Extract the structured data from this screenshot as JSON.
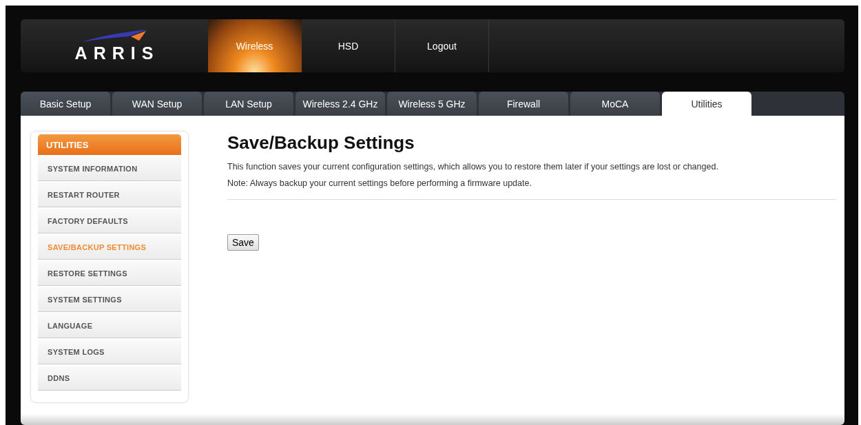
{
  "header": {
    "logo": "ARRIS",
    "nav": [
      {
        "label": "Wireless",
        "selected": true
      },
      {
        "label": "HSD",
        "selected": false
      },
      {
        "label": "Logout",
        "selected": false
      }
    ]
  },
  "tabs": [
    {
      "label": "Basic Setup",
      "selected": false
    },
    {
      "label": "WAN Setup",
      "selected": false
    },
    {
      "label": "LAN Setup",
      "selected": false
    },
    {
      "label": "Wireless 2.4 GHz",
      "selected": false
    },
    {
      "label": "Wireless 5 GHz",
      "selected": false
    },
    {
      "label": "Firewall",
      "selected": false
    },
    {
      "label": "MoCA",
      "selected": false
    },
    {
      "label": "Utilities",
      "selected": true
    }
  ],
  "sidebar": {
    "title": "UTILITIES",
    "items": [
      {
        "label": "SYSTEM INFORMATION",
        "selected": false
      },
      {
        "label": "RESTART ROUTER",
        "selected": false
      },
      {
        "label": "FACTORY DEFAULTS",
        "selected": false
      },
      {
        "label": "SAVE/BACKUP SETTINGS",
        "selected": true
      },
      {
        "label": "RESTORE SETTINGS",
        "selected": false
      },
      {
        "label": "SYSTEM SETTINGS",
        "selected": false
      },
      {
        "label": "LANGUAGE",
        "selected": false
      },
      {
        "label": "SYSTEM LOGS",
        "selected": false
      },
      {
        "label": "DDNS",
        "selected": false
      }
    ]
  },
  "content": {
    "title": "Save/Backup Settings",
    "description": "This function saves your current configuration settings, which allows you to restore them later if your settings are lost or changed.",
    "note": "Note: Always backup your current settings before performing a firmware update.",
    "button": "Save"
  }
}
